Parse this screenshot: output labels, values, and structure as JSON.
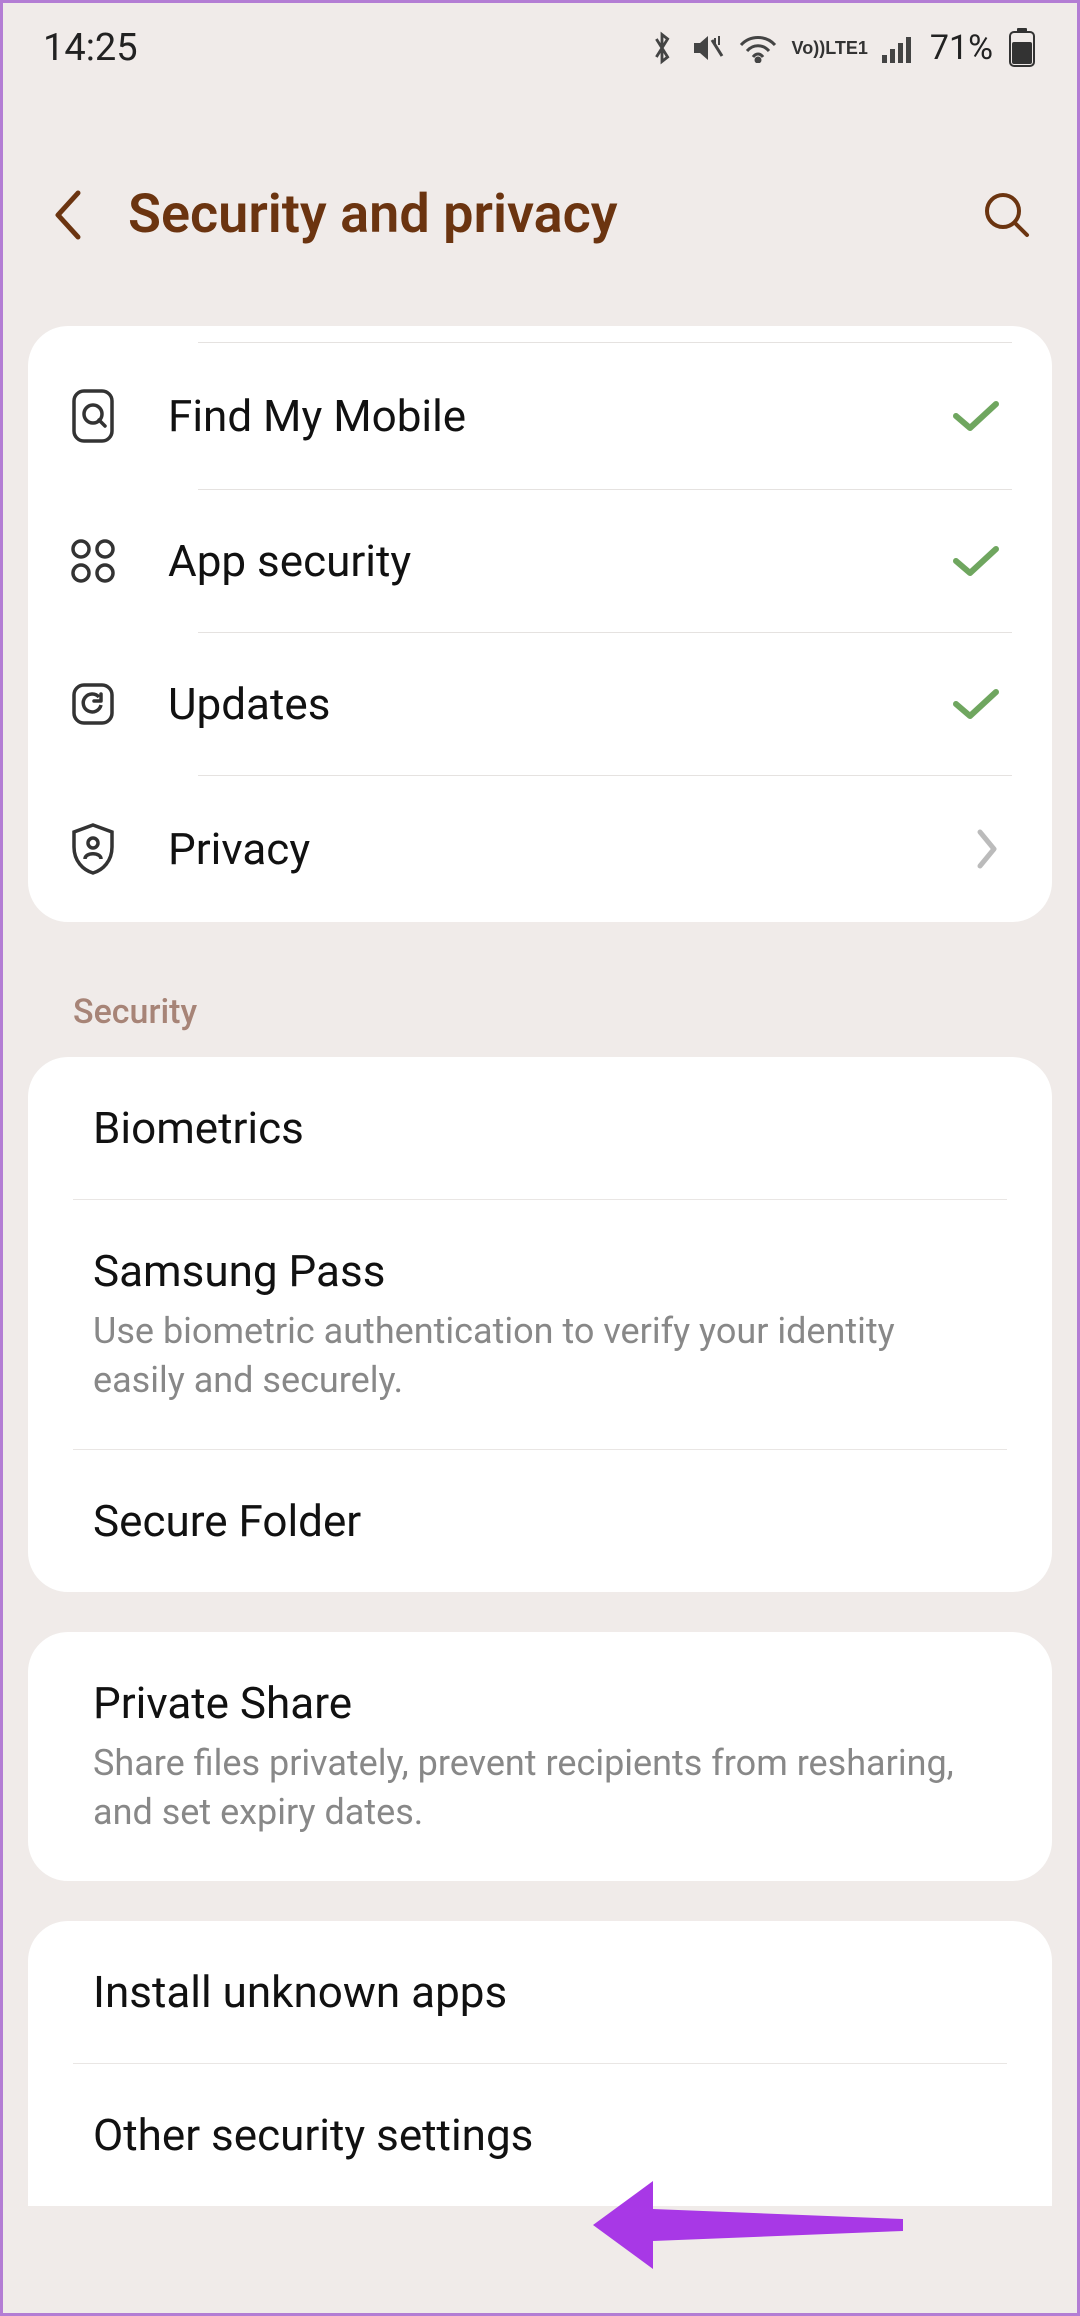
{
  "status": {
    "time": "14:25",
    "battery": "71%"
  },
  "header": {
    "title": "Security and privacy"
  },
  "group1": {
    "items": [
      {
        "label": "Find My Mobile",
        "icon": "find-icon",
        "indicator": "check"
      },
      {
        "label": "App security",
        "icon": "apps-icon",
        "indicator": "check"
      },
      {
        "label": "Updates",
        "icon": "updates-icon",
        "indicator": "check"
      },
      {
        "label": "Privacy",
        "icon": "privacy-icon",
        "indicator": "arrow"
      }
    ]
  },
  "section_label": "Security",
  "group2": {
    "items": [
      {
        "title": "Biometrics",
        "sub": ""
      },
      {
        "title": "Samsung Pass",
        "sub": "Use biometric authentication to verify your identity easily and securely."
      },
      {
        "title": "Secure Folder",
        "sub": ""
      }
    ]
  },
  "group3": {
    "items": [
      {
        "title": "Private Share",
        "sub": "Share files privately, prevent recipients from resharing, and set expiry dates."
      }
    ]
  },
  "group4": {
    "items": [
      {
        "title": "Install unknown apps",
        "sub": ""
      },
      {
        "title": "Other security settings",
        "sub": ""
      }
    ]
  }
}
